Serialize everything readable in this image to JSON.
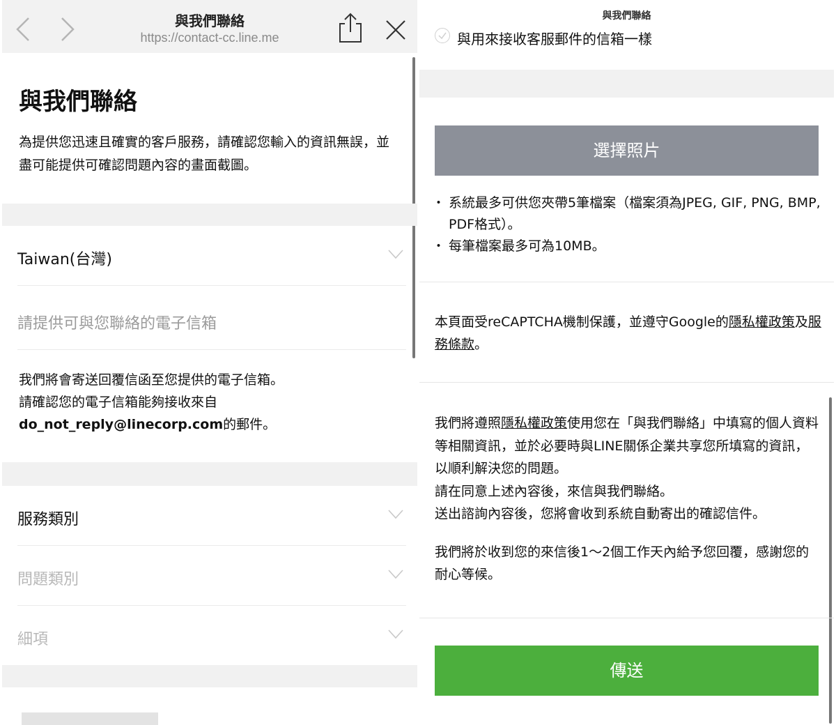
{
  "browser": {
    "title": "與我們聯絡",
    "url": "https://contact-cc.line.me",
    "right_title": "與我們聯絡"
  },
  "left": {
    "heading": "與我們聯絡",
    "intro": "為提供您迅速且確實的客戶服務，請確認您輸入的資訊無誤，並盡可能提供可確認問題內容的畫面截圖。",
    "country": "Taiwan(台灣)",
    "email_placeholder": "請提供可與您聯絡的電子信箱",
    "reply_note_1": "我們將會寄送回覆信函至您提供的電子信箱。",
    "reply_note_2": "請確認您的電子信箱能夠接收來自",
    "reply_email": "do_not_reply@linecorp.com",
    "reply_note_3": "的郵件。",
    "service_category": "服務類別",
    "issue_category": "問題類別",
    "detail": "細項"
  },
  "right": {
    "same_email_checkbox": "與用來接收客服郵件的信箱一樣",
    "select_photo_button": "選擇照片",
    "file_note_1": "系統最多可供您夾帶5筆檔案（檔案須為JPEG, GIF, PNG, BMP, PDF格式）。",
    "file_note_2": "每筆檔案最多可為10MB。",
    "recaptcha_prefix": "本頁面受reCAPTCHA機制保護，並遵守Google的",
    "recaptcha_privacy": "隱私權政策",
    "recaptcha_and": "及",
    "recaptcha_terms": "服務條款",
    "recaptcha_suffix": "。",
    "policy_prefix": "我們將遵照",
    "policy_link": "隱私權政策",
    "policy_rest": "使用您在「與我們聯絡」中填寫的個人資料等相關資訊，並於必要時與LINE關係企業共享您所填寫的資訊，以順利解決您的問題。",
    "policy_line2": "請在同意上述內容後，來信與我們聯絡。",
    "policy_line3": "送出諮詢內容後，您將會收到系統自動寄出的確認信件。",
    "reply_time": "我們將於收到您的來信後1～2個工作天內給予您回覆，感謝您的耐心等候。",
    "send_button": "傳送"
  },
  "colors": {
    "send_button": "#4caf3d",
    "select_photo_button": "#8c9099",
    "band_gray": "#f1f1f1"
  },
  "icons": [
    "back-arrow-icon",
    "forward-arrow-icon",
    "share-icon",
    "close-icon",
    "chevron-down-icon",
    "check-icon"
  ]
}
